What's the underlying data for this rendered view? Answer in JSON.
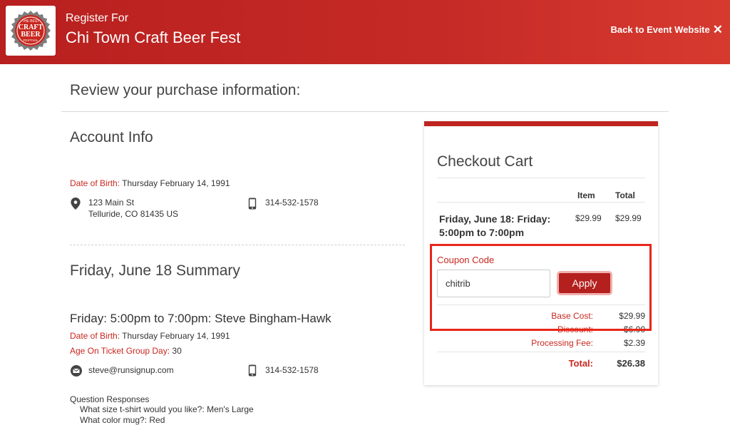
{
  "header": {
    "subtitle": "Register For",
    "title": "Chi Town Craft Beer Fest",
    "back_link": "Back to Event Website",
    "logo_text_top": "THE BEST",
    "logo_text_mid1": "CRAFT",
    "logo_text_mid2": "BEER",
    "logo_text_bottom": "FESTIVAL"
  },
  "page": {
    "review_title": "Review your purchase information:"
  },
  "account": {
    "title": "Account Info",
    "dob_label": "Date of Birth:",
    "dob_value": "Thursday February 14, 1991",
    "address_line1": "123 Main St",
    "address_line2": "Telluride, CO 81435 US",
    "phone": "314-532-1578"
  },
  "summary": {
    "title": "Friday, June 18 Summary",
    "registrant": "Friday: 5:00pm to 7:00pm: Steve Bingham-Hawk",
    "dob_label": "Date of Birth:",
    "dob_value": "Thursday February 14, 1991",
    "age_label": "Age On Ticket Group Day:",
    "age_value": "30",
    "email": "steve@runsignup.com",
    "phone": "314-532-1578",
    "questions_label": "Question Responses",
    "question1": "What size t-shirt would you like?: Men's Large",
    "question2": "What color mug?: Red"
  },
  "cart": {
    "title": "Checkout Cart",
    "col_item": "Item",
    "col_total": "Total",
    "item_name": "Friday, June 18: Friday: 5:00pm to 7:00pm",
    "item_price": "$29.99",
    "item_total": "$29.99",
    "coupon_label": "Coupon Code",
    "coupon_value": "chitrib",
    "apply_label": "Apply",
    "base_cost_label": "Base Cost:",
    "base_cost_value": "$29.99",
    "discount_label": "Discount:",
    "discount_value": "-$6.00",
    "processing_label": "Processing Fee:",
    "processing_value": "$2.39",
    "total_label": "Total:",
    "total_value": "$26.38"
  },
  "colors": {
    "brand_red": "#c0241f",
    "highlight": "#e8261a"
  }
}
